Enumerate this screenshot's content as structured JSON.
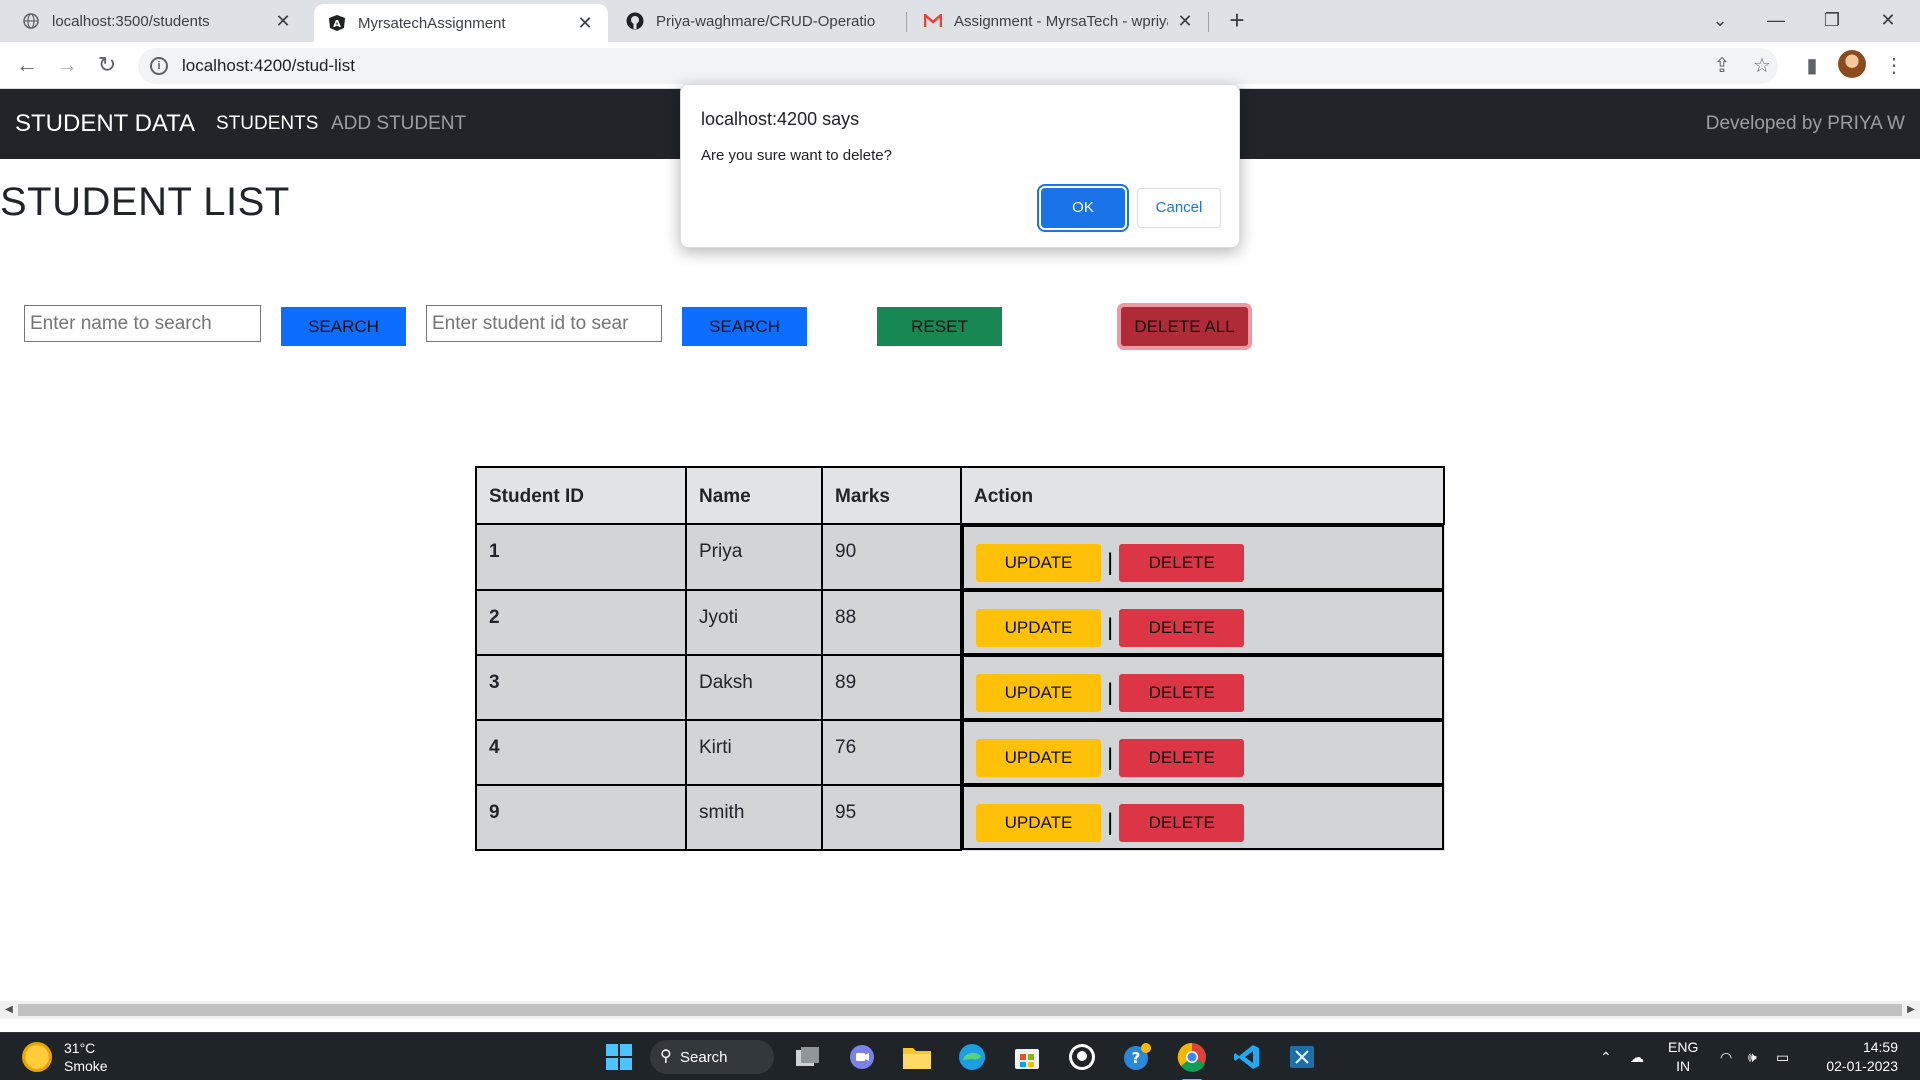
{
  "browser": {
    "tabs": [
      {
        "title": "localhost:3500/students",
        "icon": "globe-icon"
      },
      {
        "title": "MyrsatechAssignment",
        "icon": "angular-icon"
      },
      {
        "title": "Priya-waghmare/CRUD-Operatio",
        "icon": "github-icon"
      },
      {
        "title": "Assignment - MyrsaTech - wpriya",
        "icon": "gmail-icon"
      }
    ],
    "url": "localhost:4200/stud-list"
  },
  "navbar": {
    "brand": "STUDENT DATA",
    "links": [
      "STUDENTS",
      "ADD STUDENT"
    ],
    "developer": "Developed by PRIYA W"
  },
  "page": {
    "title": "STUDENT LIST",
    "name_search_placeholder": "Enter name to search",
    "id_search_placeholder": "Enter student id to sear",
    "search_label": "SEARCH",
    "reset_label": "RESET",
    "delete_all_label": "DELETE ALL"
  },
  "table": {
    "headers": [
      "Student ID",
      "Name",
      "Marks",
      "Action"
    ],
    "rows": [
      {
        "id": "1",
        "name": "Priya",
        "marks": "90"
      },
      {
        "id": "2",
        "name": "Jyoti",
        "marks": "88"
      },
      {
        "id": "3",
        "name": "Daksh",
        "marks": "89"
      },
      {
        "id": "4",
        "name": "Kirti",
        "marks": "76"
      },
      {
        "id": "9",
        "name": "smith",
        "marks": "95"
      }
    ],
    "update_label": "UPDATE",
    "delete_label": "DELETE",
    "separator": "|"
  },
  "dialog": {
    "title": "localhost:4200 says",
    "message": "Are you sure want to delete?",
    "ok": "OK",
    "cancel": "Cancel"
  },
  "taskbar": {
    "temperature": "31°C",
    "weather": "Smoke",
    "search": "Search",
    "lang_top": "ENG",
    "lang_bottom": "IN",
    "time": "14:59",
    "date": "02-01-2023"
  },
  "colors": {
    "navbar": "#212529",
    "primary": "#0d6efd",
    "success": "#198754",
    "warning": "#ffc107",
    "danger": "#dc3545",
    "dialog_ok": "#1a73e8"
  }
}
